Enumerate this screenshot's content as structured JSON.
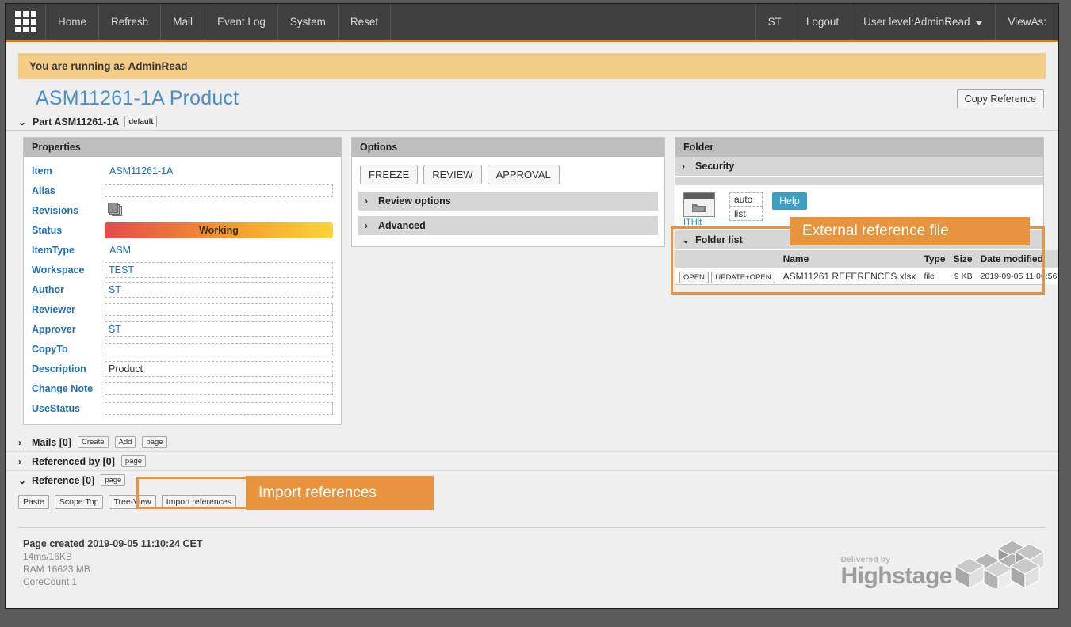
{
  "topnav": {
    "grid_icon": "apps-grid-icon",
    "items": [
      "Home",
      "Refresh",
      "Mail",
      "Event Log",
      "System",
      "Reset"
    ],
    "right_items": [
      "ST",
      "Logout"
    ],
    "user_level": "User level:AdminRead",
    "view_as": "ViewAs:"
  },
  "banner": {
    "text": "You are running as AdminRead"
  },
  "header": {
    "title": "ASM11261-1A Product",
    "copy_reference": "Copy Reference"
  },
  "part_section": {
    "chevron": "⌄",
    "label": "Part ASM11261-1A",
    "badge": "default"
  },
  "properties": {
    "panel_title": "Properties",
    "rows": [
      {
        "label": "Item",
        "value": "ASM11261-1A",
        "style": "plain"
      },
      {
        "label": "Alias",
        "value": "",
        "style": "boxed"
      },
      {
        "label": "Revisions",
        "value": "",
        "style": "icon"
      },
      {
        "label": "Status",
        "value": "Working",
        "style": "status"
      },
      {
        "label": "ItemType",
        "value": "ASM",
        "style": "plain"
      },
      {
        "label": "Workspace",
        "value": "TEST",
        "style": "boxed"
      },
      {
        "label": "Author",
        "value": "ST",
        "style": "boxed"
      },
      {
        "label": "Reviewer",
        "value": "",
        "style": "boxed"
      },
      {
        "label": "Approver",
        "value": "ST",
        "style": "boxed"
      },
      {
        "label": "CopyTo",
        "value": "",
        "style": "boxed"
      },
      {
        "label": "Description",
        "value": "Product",
        "style": "boxed-dark"
      },
      {
        "label": "Change Note",
        "value": "",
        "style": "boxed"
      },
      {
        "label": "UseStatus",
        "value": "",
        "style": "boxed"
      }
    ],
    "revisions_icon": "stacked-pages-icon"
  },
  "options": {
    "panel_title": "Options",
    "buttons": [
      "FREEZE",
      "REVIEW",
      "APPROVAL"
    ],
    "collapsibles": [
      {
        "chevron": "›",
        "label": "Review options"
      },
      {
        "chevron": "›",
        "label": "Advanced"
      }
    ]
  },
  "folder": {
    "panel_title": "Folder",
    "security": {
      "chevron": "›",
      "label": "Security"
    },
    "folder_icon": "folder-open-icon",
    "ithit_link": "ITHit",
    "auto_label": "auto",
    "list_label": "list",
    "help_button": "Help",
    "folder_list": {
      "chevron": "⌄",
      "label": "Folder list"
    },
    "table": {
      "columns": [
        "",
        "Name",
        "Type",
        "Size",
        "Date modified"
      ],
      "rows": [
        {
          "open_button": "OPEN",
          "update_open_button": "UPDATE+OPEN",
          "name": "ASM11261 REFERENCES.xlsx",
          "type": "file",
          "size": "9 KB",
          "date_modified": "2019-09-05 11:06:56"
        }
      ]
    }
  },
  "bottom_sections": [
    {
      "chevron": "›",
      "label": "Mails [0]",
      "buttons": [
        "Create",
        "Add",
        "page"
      ]
    },
    {
      "chevron": "›",
      "label": "Referenced by [0]",
      "buttons": [
        "page"
      ]
    },
    {
      "chevron": "⌄",
      "label": "Reference [0]",
      "buttons": [
        "page"
      ]
    }
  ],
  "reference_tools": [
    "Paste",
    "Scope:Top",
    "Tree-View",
    "Import references"
  ],
  "callouts": [
    {
      "text": "External reference file"
    },
    {
      "text": "Import references"
    }
  ],
  "footer": {
    "page_created": "Page created 2019-09-05 11:10:24 CET",
    "timing": "14ms/16KB",
    "ram": "RAM 16623 MB",
    "corecount": "CoreCount 1",
    "delivered_by": "Delivered by",
    "brand": "Highstage"
  },
  "colors": {
    "accent_orange": "#e8943f",
    "nav_dark": "#3f3f3f",
    "nav_underline": "#d2801e",
    "banner_yellow": "#f3cd87",
    "link_blue": "#1f6fb5",
    "title_blue": "#4a90c4",
    "help_blue": "#3b9fc4"
  }
}
